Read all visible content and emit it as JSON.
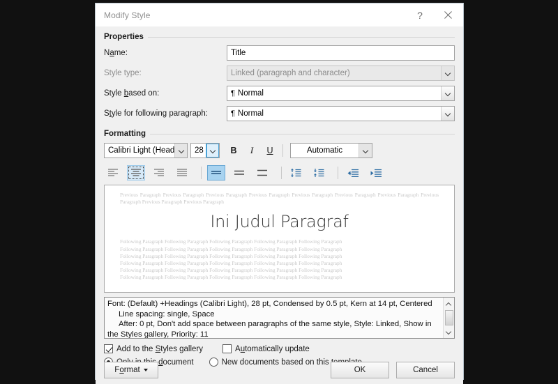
{
  "window": {
    "title": "Modify Style",
    "help_label": "?",
    "close_label": "✕"
  },
  "properties": {
    "group_label": "Properties",
    "name": {
      "label_pre": "N",
      "label_key": "a",
      "label_post": "me:",
      "value": "Title"
    },
    "style_type": {
      "label_pre": "Style type:",
      "label_key": "",
      "label_post": "",
      "value": "Linked (paragraph and character)"
    },
    "style_based_on": {
      "label_pre": "Style ",
      "label_key": "b",
      "label_post": "ased on:",
      "value": "Normal",
      "glyph": "¶"
    },
    "style_following": {
      "label_pre": "S",
      "label_key": "t",
      "label_post": "yle for following paragraph:",
      "value": "Normal",
      "glyph": "¶"
    }
  },
  "formatting": {
    "group_label": "Formatting",
    "font_family": "Calibri Light (Head",
    "font_size": "28",
    "bold_label": "B",
    "italic_label": "I",
    "underline_label": "U",
    "font_color": "Automatic",
    "align_buttons": [
      {
        "name": "align-left-button",
        "state": "normal"
      },
      {
        "name": "align-center-button",
        "state": "selected-focus"
      },
      {
        "name": "align-right-button",
        "state": "normal"
      },
      {
        "name": "align-justify-button",
        "state": "normal"
      }
    ],
    "spacing_buttons": [
      {
        "name": "line-spacing-single-button",
        "state": "selected"
      },
      {
        "name": "line-spacing-1-5-button",
        "state": "normal"
      },
      {
        "name": "line-spacing-double-button",
        "state": "normal"
      }
    ],
    "space_buttons": [
      {
        "name": "increase-paragraph-spacing-button"
      },
      {
        "name": "decrease-paragraph-spacing-button"
      }
    ],
    "indent_buttons": [
      {
        "name": "decrease-indent-button"
      },
      {
        "name": "increase-indent-button"
      }
    ]
  },
  "preview": {
    "previous_paragraph": "Previous Paragraph Previous Paragraph Previous Paragraph Previous Paragraph Previous Paragraph Previous Paragraph Previous Paragraph Previous Paragraph Previous Paragraph Previous Paragraph",
    "title_text": "Ini Judul Paragraf",
    "following_line": "Following Paragraph Following Paragraph Following Paragraph Following Paragraph Following Paragraph",
    "following_count": 6
  },
  "description": {
    "line1": "Font: (Default) +Headings (Calibri Light), 28 pt, Condensed by  0.5 pt, Kern at 14 pt, Centered",
    "line2": "Line spacing:  single, Space",
    "line3": "After:  0 pt, Don't add space between paragraphs of the same style, Style: Linked, Show in",
    "line4": "the Styles gallery, Priority: 11"
  },
  "options": {
    "add_gallery": {
      "label_pre": "Add to the ",
      "label_key": "S",
      "label_post": "tyles gallery",
      "checked": true
    },
    "auto_update": {
      "label_pre": "A",
      "label_key": "u",
      "label_post": "tomatically update",
      "checked": false
    },
    "only_document": {
      "label_pre": "Only in this ",
      "label_key": "d",
      "label_post": "ocument",
      "selected": true
    },
    "new_documents": {
      "label_pre": "New documents based on this template",
      "label_key": "",
      "label_post": "",
      "selected": false
    }
  },
  "buttons": {
    "format": {
      "label_pre": "F",
      "label_key": "o",
      "label_post": "rmat"
    },
    "ok": "OK",
    "cancel": "Cancel"
  },
  "colors": {
    "accent_blue": "#2a7fb5",
    "selected_blue": "#a8d3f0",
    "icon_blue": "#2e6da4",
    "dialog_bg": "#f0f0f0",
    "backdrop": "#111111"
  }
}
